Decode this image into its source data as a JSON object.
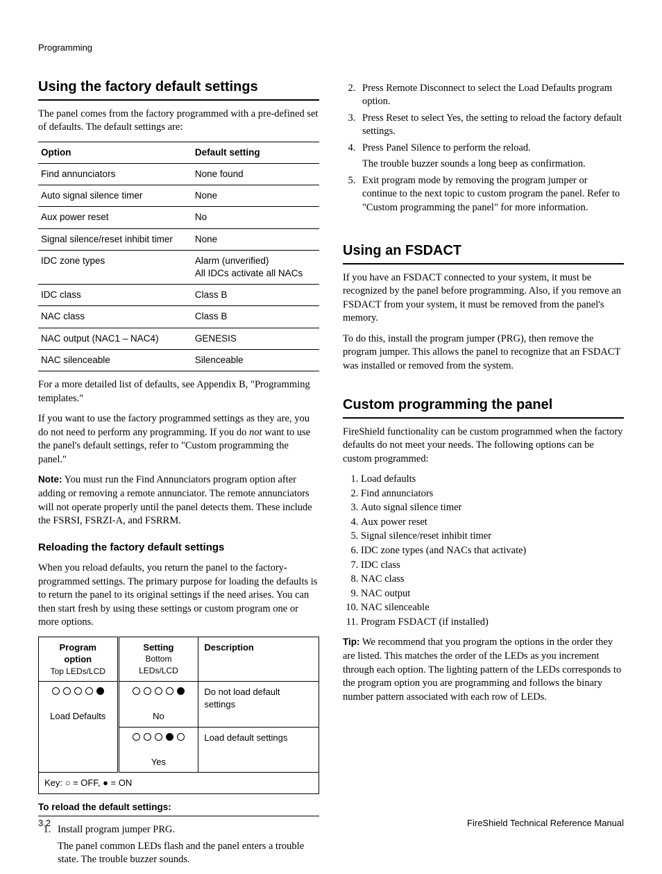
{
  "running_head": "Programming",
  "footer": {
    "left": "3.2",
    "right": "FireShield Technical Reference Manual"
  },
  "left": {
    "h_defaults": "Using the factory default settings",
    "p_intro": "The panel comes from the factory programmed with a pre-defined set of defaults. The default settings are:",
    "defaults_table": {
      "headers": [
        "Option",
        "Default setting"
      ],
      "rows": [
        [
          "Find annunciators",
          "None found"
        ],
        [
          "Auto signal silence timer",
          "None"
        ],
        [
          "Aux power reset",
          "No"
        ],
        [
          "Signal silence/reset inhibit timer",
          "None"
        ],
        [
          "IDC zone types",
          "Alarm (unverified)\nAll IDCs activate all NACs"
        ],
        [
          "IDC class",
          "Class B"
        ],
        [
          "NAC class",
          "Class B"
        ],
        [
          "NAC output (NAC1 – NAC4)",
          "GENESIS"
        ],
        [
          "NAC silenceable",
          "Silenceable"
        ]
      ]
    },
    "p_after_tbl": "For a more detailed list of defaults, see Appendix B, \"Programming templates.\"",
    "p_if_use": "If you want to use the factory programmed settings as they are, you do not need to perform any programming. If you do ",
    "p_if_use_em": "not",
    "p_if_use_tail": " want to use the panel's default settings, refer to \"Custom programming the panel.\"",
    "note_label": "Note:",
    "note_body": " You must run the Find Annunciators program option after adding or removing a remote annunciator. The remote annunciators will not operate properly until the panel detects them. These include the FSRSI, FSRZI-A, and FSRRM.",
    "h_reload": "Reloading the factory default settings",
    "p_reload": "When you reload defaults, you return the panel to the factory-programmed settings. The primary purpose for loading the defaults is to return the panel to its original settings if the need arises. You can then start fresh by using these settings or custom program one or more options.",
    "load_table": {
      "h1a": "Program option",
      "h1b": "Top LEDs/LCD",
      "h2a": "Setting",
      "h2b": "Bottom LEDs/LCD",
      "h3": "Description",
      "prog_label": "Load Defaults",
      "row1_setting": "No",
      "row1_desc": "Do not load default settings",
      "row2_setting": "Yes",
      "row2_desc": "Load default settings",
      "key_text": "Key: ○ = OFF, ● = ON"
    },
    "to_reload_heading": "To reload the default settings:",
    "step1": "Install program jumper PRG.",
    "step1_body": "The panel common LEDs flash and the panel enters a trouble state. The trouble buzzer sounds."
  },
  "right": {
    "step2": "Press Remote Disconnect to select the Load Defaults program option.",
    "step3": "Press Reset to select Yes, the setting to reload the factory default settings.",
    "step4": "Press Panel Silence to perform the reload.",
    "step4_body": "The trouble buzzer sounds a long beep as confirmation.",
    "step5": "Exit program mode by removing the program jumper or continue to the next topic to custom program the panel. Refer to \"Custom programming the panel\" for more information.",
    "h_fsdact": "Using an FSDACT",
    "p_fsdact1": "If you have an FSDACT connected to your system, it must be recognized by the panel before programming. Also, if you remove an FSDACT from your system, it must be removed from the panel's memory.",
    "p_fsdact2": "To do this, install the program jumper (PRG), then remove the program jumper. This allows the panel to recognize that an FSDACT was installed or removed from the system.",
    "h_custom": "Custom programming the panel",
    "p_custom": "FireShield functionality can be custom programmed when the factory defaults do not meet your needs. The following options can be custom programmed:",
    "options": [
      "Load defaults",
      "Find annunciators",
      "Auto signal silence timer",
      "Aux power reset",
      "Signal silence/reset inhibit timer",
      "IDC zone types (and NACs that activate)",
      "IDC class",
      "NAC class",
      "NAC output",
      "NAC silenceable",
      "Program FSDACT (if installed)"
    ],
    "tip_label": "Tip:",
    "tip_body": " We recommend that you program the options in the order they are listed. This matches the order of the LEDs as you increment through each option. The lighting pattern of the LEDs corresponds to the program option you are programming and follows the binary number pattern associated with each row of LEDs."
  }
}
